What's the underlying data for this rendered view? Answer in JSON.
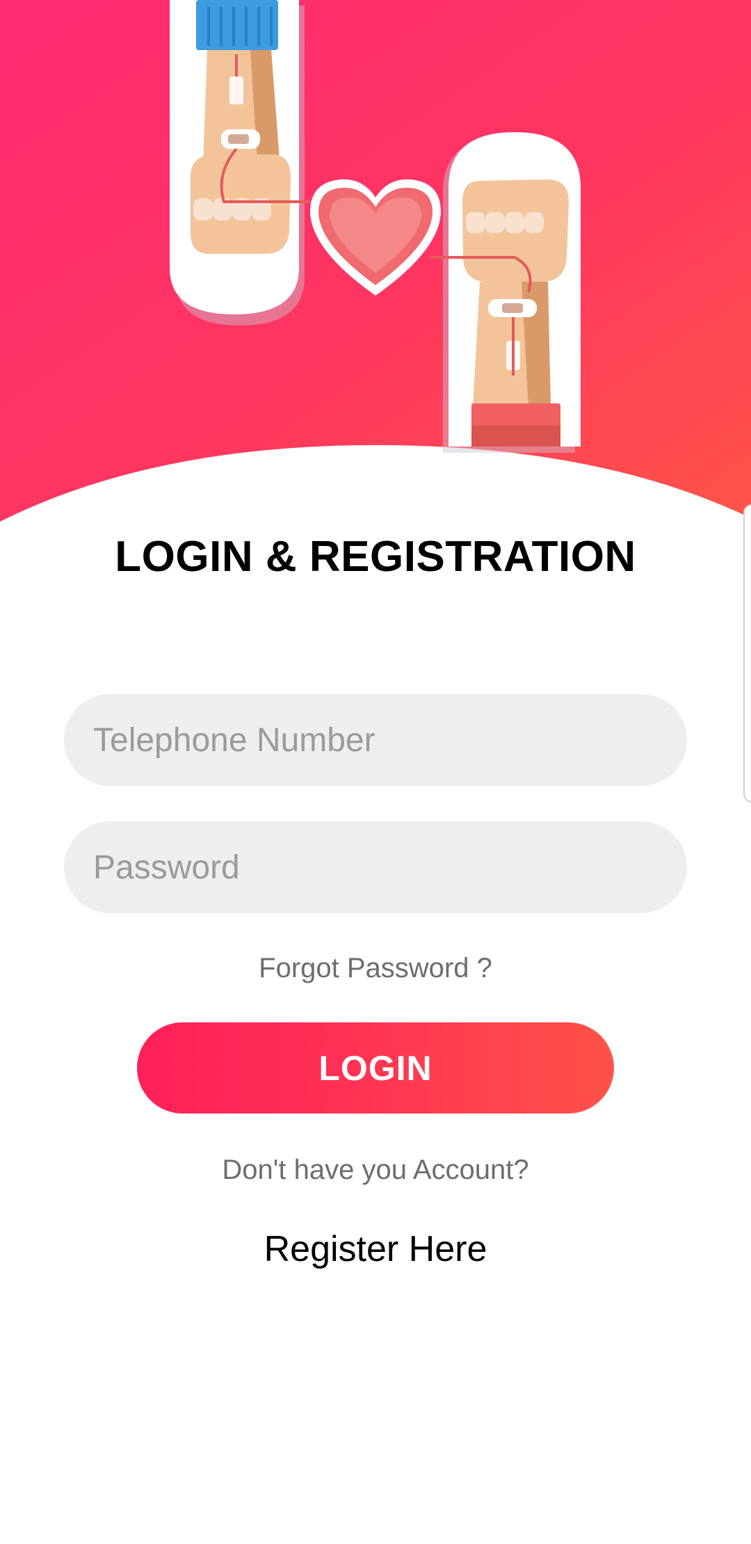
{
  "header": {
    "title": "LOGIN & REGISTRATION"
  },
  "form": {
    "phone": {
      "placeholder": "Telephone Number",
      "value": ""
    },
    "password": {
      "placeholder": "Password",
      "value": ""
    },
    "forgot_label": "Forgot Password ?",
    "login_label": "LOGIN"
  },
  "footer": {
    "no_account_text": "Don't have you Account?",
    "register_label": "Register Here"
  },
  "colors": {
    "brand_pink": "#ff2a5f",
    "brand_coral": "#ff5248",
    "field_bg": "#eeeeee"
  },
  "icons": {
    "hero": "blood-donation-illustration"
  }
}
